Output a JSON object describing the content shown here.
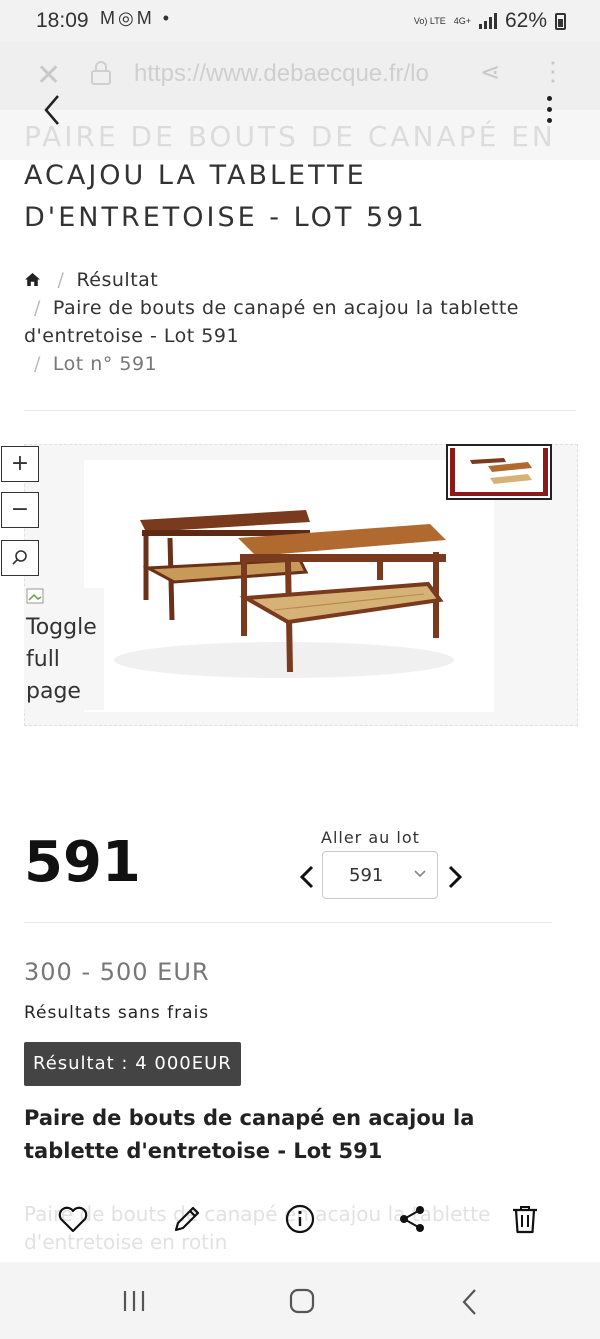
{
  "status_bar": {
    "time": "18:09",
    "notification_icons": [
      "gmail-icon",
      "instagram-icon",
      "gmail-icon"
    ],
    "notification_dot": "•",
    "network": "4G+",
    "volte": "Vo) LTE",
    "battery": "62%"
  },
  "browser": {
    "url": "https://www.debaecque.fr/lo"
  },
  "page": {
    "ghost_title": "PAIRE DE BOUTS DE CANAPÉ EN",
    "title_lines": [
      "ACAJOU LA TABLETTE",
      "D'ENTRETOISE - LOT 591"
    ]
  },
  "breadcrumb": {
    "separator": "/",
    "result": "Résultat",
    "item": "Paire de bouts de canapé en acajou la tablette d'entretoise - Lot 591",
    "lot": "Lot n° 591"
  },
  "gallery": {
    "zoom_in": "+",
    "zoom_out": "−",
    "toggle_text": "Toggle full page"
  },
  "lot": {
    "number": "591",
    "goto_label": "Aller au lot",
    "goto_value": "591",
    "estimate": "300 - 500 EUR",
    "fees_note": "Résultats sans frais",
    "result": "Résultat : 4 000EUR",
    "description_title": "Paire de bouts de canapé en acajou la tablette d'entretoise - Lot 591",
    "description_faded": "Paire de bouts de canapé en acajou la tablette d'entretoise en rotin"
  },
  "colors": {
    "accent_dark": "#444444",
    "thumb_border": "#222222",
    "wood": "#a0522d"
  }
}
